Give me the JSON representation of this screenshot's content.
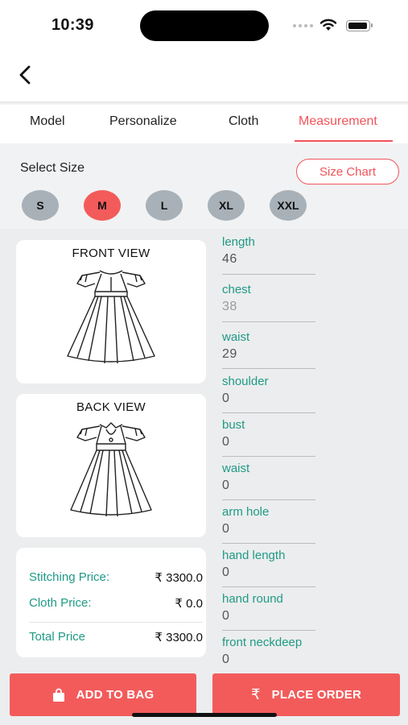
{
  "status_bar": {
    "time": "10:39"
  },
  "tabs": [
    {
      "label": "Model"
    },
    {
      "label": "Personalize"
    },
    {
      "label": "Cloth"
    },
    {
      "label": "Measurement",
      "active": true
    }
  ],
  "size_section": {
    "title": "Select Size",
    "size_chart_label": "Size Chart",
    "sizes": [
      "S",
      "M",
      "L",
      "XL",
      "XXL"
    ],
    "selected": "M"
  },
  "views": {
    "front": "FRONT VIEW",
    "back": "BACK VIEW"
  },
  "measurements": [
    {
      "label": "length",
      "value": "46"
    },
    {
      "label": "chest",
      "value": "38"
    },
    {
      "label": "waist",
      "value": "29"
    },
    {
      "label": "shoulder",
      "value": "0"
    },
    {
      "label": "bust",
      "value": "0"
    },
    {
      "label": "waist",
      "value": "0"
    },
    {
      "label": "arm hole",
      "value": "0"
    },
    {
      "label": "hand length",
      "value": "0"
    },
    {
      "label": "hand round",
      "value": "0"
    },
    {
      "label": "front neckdeep",
      "value": "0"
    }
  ],
  "pricing": {
    "stitching_label": "Stitching Price:",
    "stitching_value": "₹ 3300.0",
    "cloth_label": "Cloth Price:",
    "cloth_value": "₹ 0.0",
    "total_label": "Total Price",
    "total_value": "₹ 3300.0"
  },
  "actions": {
    "add_to_bag": "ADD TO BAG",
    "place_order": "PLACE ORDER",
    "rupee_symbol": "₹"
  },
  "colors": {
    "accent": "#f35b5b",
    "label_green": "#1f9a86",
    "chip_gray": "#a8b1b8"
  },
  "icons": {
    "back": "chevron-left-icon",
    "bag": "shopping-bag-icon",
    "rupee": "rupee-icon"
  }
}
